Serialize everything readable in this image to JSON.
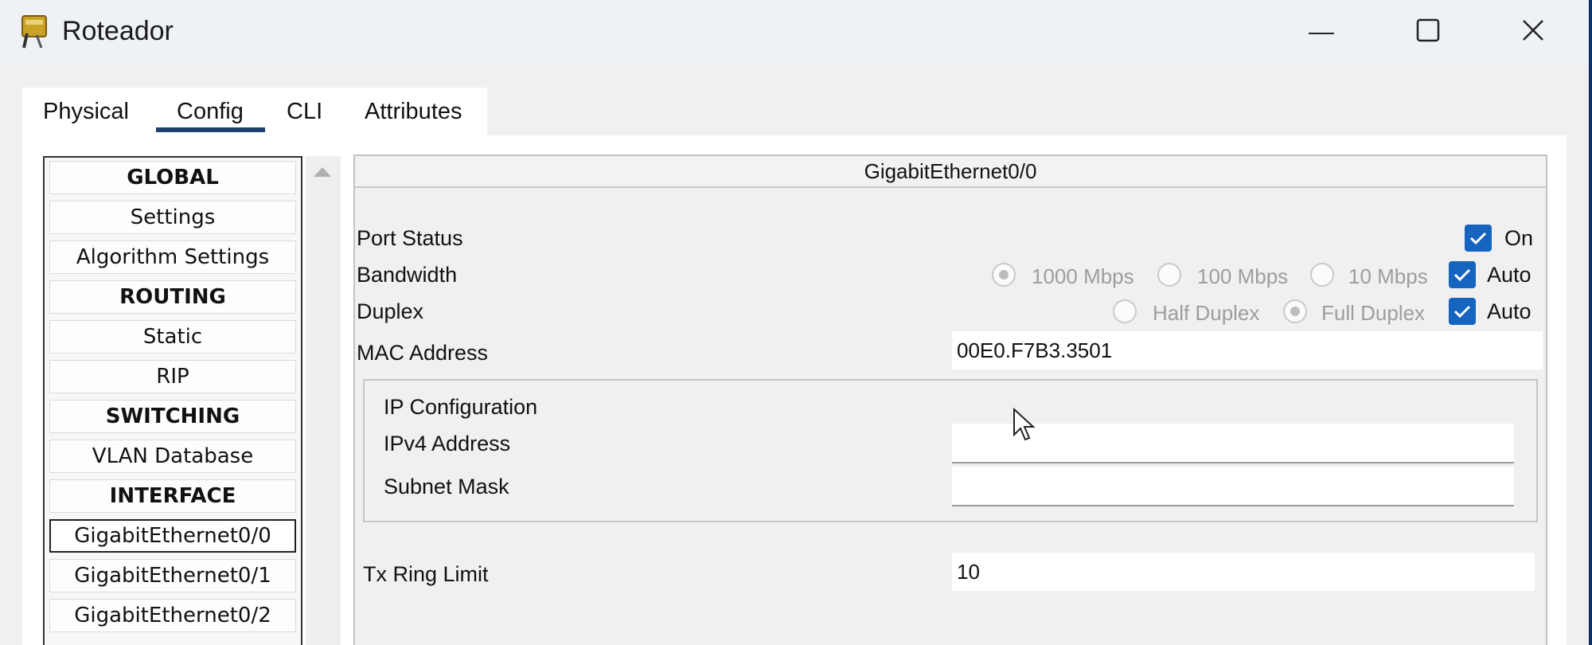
{
  "window": {
    "title": "Roteador",
    "icon": "router-icon",
    "controls": [
      "minimize-icon",
      "maximize-icon",
      "close-icon"
    ]
  },
  "tabs": [
    {
      "label": "Physical",
      "active": false
    },
    {
      "label": "Config",
      "active": true
    },
    {
      "label": "CLI",
      "active": false
    },
    {
      "label": "Attributes",
      "active": false
    }
  ],
  "sidebar": {
    "items": [
      {
        "label": "GLOBAL",
        "header": true
      },
      {
        "label": "Settings",
        "header": false
      },
      {
        "label": "Algorithm Settings",
        "header": false
      },
      {
        "label": "ROUTING",
        "header": true
      },
      {
        "label": "Static",
        "header": false
      },
      {
        "label": "RIP",
        "header": false
      },
      {
        "label": "SWITCHING",
        "header": true
      },
      {
        "label": "VLAN Database",
        "header": false
      },
      {
        "label": "INTERFACE",
        "header": true
      },
      {
        "label": "GigabitEthernet0/0",
        "header": false,
        "selected": true
      },
      {
        "label": "GigabitEthernet0/1",
        "header": false
      },
      {
        "label": "GigabitEthernet0/2",
        "header": false
      }
    ]
  },
  "interface": {
    "title": "GigabitEthernet0/0",
    "port_status": {
      "label": "Port Status",
      "on_label": "On",
      "on": true
    },
    "bandwidth": {
      "label": "Bandwidth",
      "options": [
        "1000 Mbps",
        "100 Mbps",
        "10 Mbps"
      ],
      "selected": "1000 Mbps",
      "auto_label": "Auto",
      "auto": true
    },
    "duplex": {
      "label": "Duplex",
      "options": [
        "Half Duplex",
        "Full Duplex"
      ],
      "selected": "Full Duplex",
      "auto_label": "Auto",
      "auto": true
    },
    "mac": {
      "label": "MAC Address",
      "value": "00E0.F7B3.3501"
    },
    "ip_config": {
      "title": "IP Configuration",
      "ipv4_label": "IPv4 Address",
      "ipv4_value": "",
      "mask_label": "Subnet Mask",
      "mask_value": ""
    },
    "tx_ring": {
      "label": "Tx Ring Limit",
      "value": "10"
    }
  },
  "colors": {
    "accent": "#1565c0",
    "tab_underline": "#1f3f6e",
    "title_bar": "#eef1f6"
  }
}
